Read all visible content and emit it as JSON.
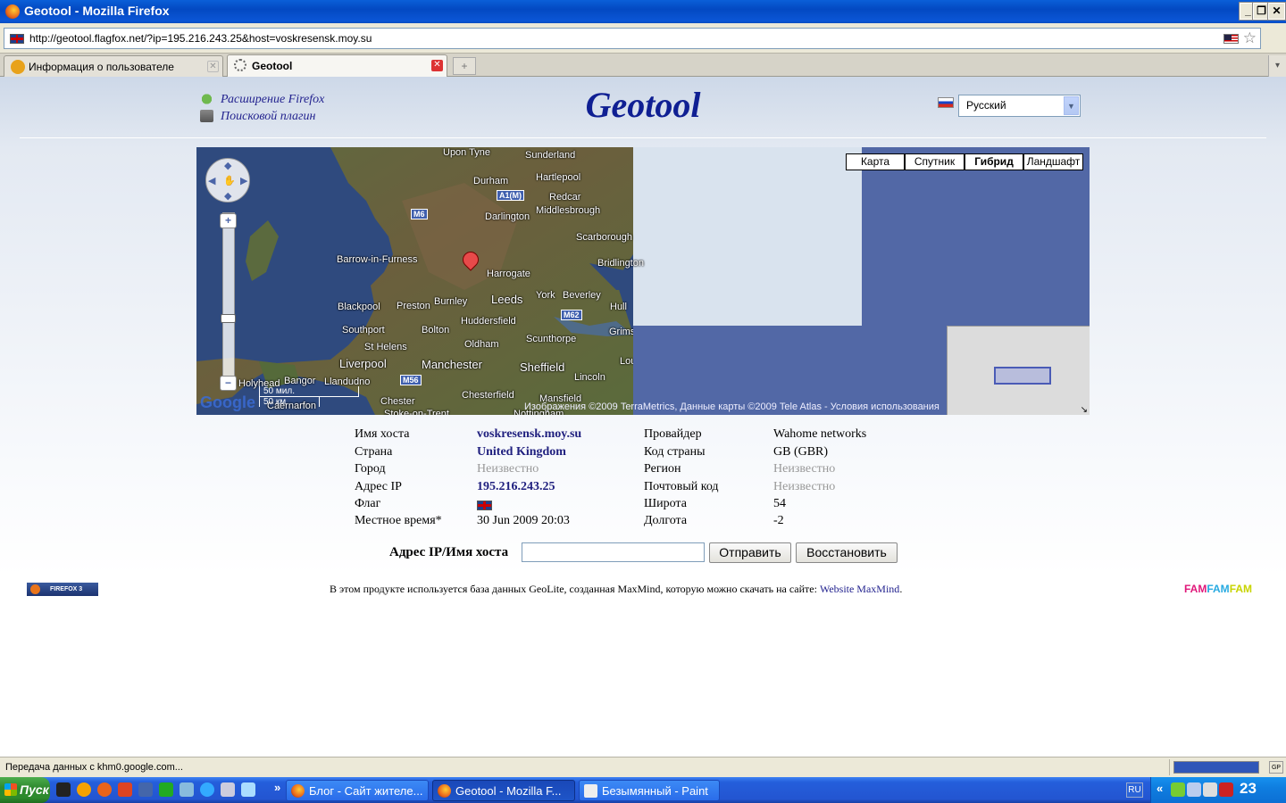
{
  "window": {
    "title": "Geotool - Mozilla Firefox",
    "controls": {
      "minimize": "_",
      "restore": "❐",
      "close": "✕"
    }
  },
  "browser": {
    "url": "http://geotool.flagfox.net/?ip=195.216.243.25&host=voskresensk.moy.su",
    "tabs": [
      {
        "label": "Информация о пользователе",
        "icon": "page-favicon"
      },
      {
        "label": "Geotool",
        "icon": "loading-spinner"
      }
    ],
    "new_tab": "+",
    "tab_list": "▾",
    "bookmark_star": "☆"
  },
  "header": {
    "links": [
      "Расширение Firefox",
      "Поисковой плагин"
    ],
    "title": "Geotool",
    "language": "Русский",
    "language_arrow": "▼"
  },
  "map": {
    "types": [
      "Карта",
      "Спутник",
      "Гибрид",
      "Ландшафт"
    ],
    "active_type": "Гибрид",
    "zoom_in": "+",
    "zoom_out": "−",
    "scale_top": "50 мил.",
    "scale_bottom": "50 км",
    "copyright": "Изображения ©2009 TerraMetrics, Данные карты ©2009 Tele Atlas - Условия использования",
    "logo": "Google",
    "places": [
      "Upon Tyne",
      "Sunderland",
      "Durham",
      "Hartlepool",
      "Redcar",
      "Darlington",
      "Middlesbrough",
      "Scarborough",
      "Bridlington",
      "Barrow-in-Furness",
      "Harrogate",
      "York",
      "Beverley",
      "Leeds",
      "Blackpool",
      "Preston",
      "Burnley",
      "Hull",
      "Huddersfield",
      "Southport",
      "Bolton",
      "Oldham",
      "Scunthorpe",
      "Grimsby",
      "St Helens",
      "Liverpool",
      "Manchester",
      "Sheffield",
      "Lincoln",
      "Holyhead",
      "Bangor",
      "Llandudno",
      "Chester",
      "Chesterfield",
      "Mansfield",
      "Caernarfon",
      "Stoke-on-Trent",
      "Nottingham",
      "Louth"
    ],
    "roads": [
      "A1(M)",
      "M6",
      "M62",
      "M56"
    ]
  },
  "info": {
    "left": [
      {
        "label": "Имя хоста",
        "value": "voskresensk.moy.su",
        "style": "val"
      },
      {
        "label": "Страна",
        "value": "United Kingdom",
        "style": "val"
      },
      {
        "label": "Город",
        "value": "Неизвестно",
        "style": "unknown"
      },
      {
        "label": "Адрес IP",
        "value": "195.216.243.25",
        "style": "val"
      },
      {
        "label": "Флаг",
        "value": "",
        "style": "flag"
      },
      {
        "label": "Местное время*",
        "value": "30 Jun 2009 20:03",
        "style": "plain"
      }
    ],
    "right": [
      {
        "label": "Провайдер",
        "value": "Wahome networks",
        "style": "plain"
      },
      {
        "label": "Код страны",
        "value": "GB (GBR)",
        "style": "plain"
      },
      {
        "label": "Регион",
        "value": "Неизвестно",
        "style": "unknown"
      },
      {
        "label": "Почтовый код",
        "value": "Неизвестно",
        "style": "unknown"
      },
      {
        "label": "Широта",
        "value": "54",
        "style": "plain"
      },
      {
        "label": "Долгота",
        "value": "-2",
        "style": "plain"
      }
    ]
  },
  "lookup": {
    "label": "Адрес IP/Имя хоста",
    "value": "",
    "submit": "Отправить",
    "reset": "Восстановить"
  },
  "footer": {
    "badge": "FIREFOX 3",
    "text": "В этом продукте используется база данных GeoLite, созданная MaxMind, которую можно скачать на сайте: ",
    "link": "Website MaxMind",
    "trailing": ".",
    "famfam": [
      "FAM",
      "FAM",
      "FAM"
    ],
    "famfam_colors": [
      "#e0187a",
      "#27aae1",
      "#c8d400"
    ]
  },
  "status": {
    "text": "Передача данных с khm0.google.com...",
    "progress": 1.0,
    "corner_badge": "GP"
  },
  "taskbar": {
    "start": "Пуск",
    "tasks": [
      {
        "label": "Блог - Сайт жителе...",
        "active": false
      },
      {
        "label": "Geotool - Mozilla F...",
        "active": true
      },
      {
        "label": "Безымянный - Paint",
        "active": false
      }
    ],
    "overflow": "»",
    "lang": "RU",
    "tray_chevron": "«",
    "clock": "23"
  }
}
